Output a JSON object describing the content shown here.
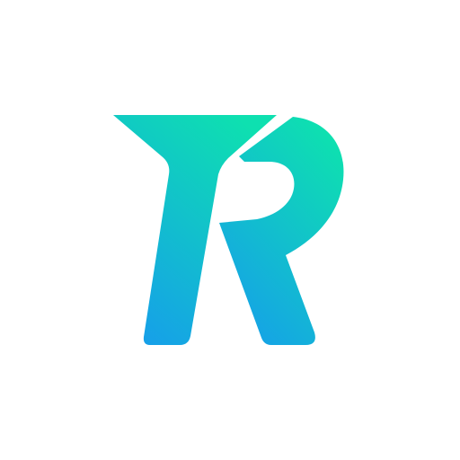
{
  "logo": {
    "icon": "tr-monogram-logo",
    "letters": "TR",
    "colors": {
      "gradient_top": "#0EE0B0",
      "gradient_bottom": "#169EEA",
      "background": "#FFFFFF"
    }
  }
}
